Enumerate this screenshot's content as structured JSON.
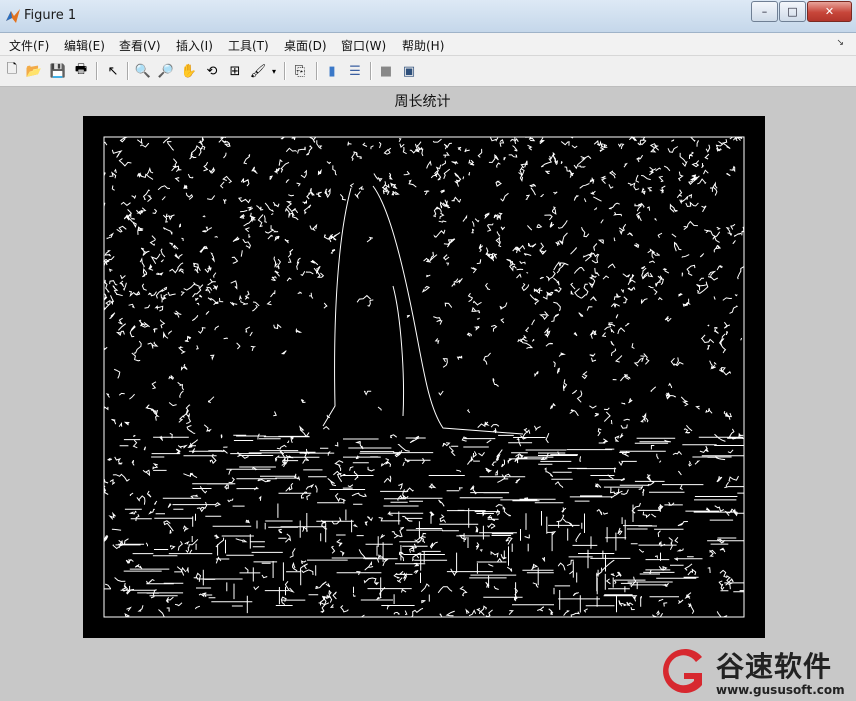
{
  "window": {
    "title": "Figure 1",
    "controls": {
      "minimize": "–",
      "maximize": "□",
      "close": "✕"
    }
  },
  "menu": {
    "items": [
      "文件(F)",
      "编辑(E)",
      "查看(V)",
      "插入(I)",
      "工具(T)",
      "桌面(D)",
      "窗口(W)",
      "帮助(H)"
    ],
    "overflow_arrow": "↘"
  },
  "toolbar": {
    "icons": [
      "new-figure-icon",
      "open-file-icon",
      "save-icon",
      "print-icon",
      "pointer-icon",
      "zoom-in-icon",
      "zoom-out-icon",
      "pan-hand-icon",
      "rotate-3d-icon",
      "data-cursor-icon",
      "brush-icon",
      "link-plot-icon",
      "colorbar-icon",
      "legend-icon",
      "hide-plot-tools-icon",
      "show-plot-tools-icon"
    ],
    "glyphs": [
      "🗋",
      "📂",
      "💾",
      "🖶",
      "↖",
      "🔍",
      "🔎",
      "✋",
      "⟲",
      "⊞",
      "🖌",
      "⎘",
      "▮",
      "☰",
      "■",
      "▣"
    ]
  },
  "plot": {
    "title": "周长统计",
    "colors": {
      "background": "#000000",
      "edges": "#ffffff",
      "figure": "#c8c8c8"
    }
  },
  "watermark": {
    "text": "谷速软件",
    "url": "www.gususoft.com",
    "colors": {
      "red": "#d7282f",
      "dark": "#222222"
    }
  }
}
